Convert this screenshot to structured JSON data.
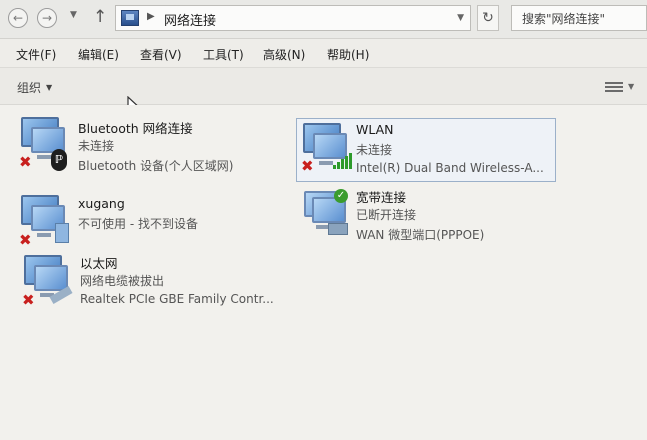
{
  "address": {
    "back_icon": "back-arrow-icon",
    "forward_icon": "forward-arrow-icon",
    "up_icon": "up-arrow-icon",
    "breadcrumb_separator": "▶",
    "path": "网络连接",
    "refresh_icon": "refresh-icon",
    "search_placeholder": "搜索\"网络连接\""
  },
  "menu": {
    "items": [
      {
        "label": "文件(F)"
      },
      {
        "label": "编辑(E)"
      },
      {
        "label": "查看(V)"
      },
      {
        "label": "工具(T)"
      },
      {
        "label": "高级(N)"
      },
      {
        "label": "帮助(H)"
      }
    ]
  },
  "toolbar": {
    "organize_label": "组织",
    "view_icon": "change-view-icon"
  },
  "connections": [
    {
      "name": "Bluetooth 网络连接",
      "status": "未连接",
      "device": "Bluetooth 设备(个人区域网)",
      "state": "disconnected",
      "type": "bluetooth"
    },
    {
      "name": "WLAN",
      "status": "未连接",
      "device": "Intel(R) Dual Band Wireless-A...",
      "state": "disconnected",
      "type": "wireless",
      "selected": true
    },
    {
      "name": "xugang",
      "status": "不可使用 - 找不到设备",
      "device": "",
      "state": "disconnected",
      "type": "vpn"
    },
    {
      "name": "宽带连接",
      "status": "已断开连接",
      "device": "WAN 微型端口(PPPOE)",
      "state": "ok",
      "type": "broadband"
    },
    {
      "name": "以太网",
      "status": "网络电缆被拔出",
      "device": "Realtek PCIe GBE Family Contr...",
      "state": "disconnected",
      "type": "ethernet"
    }
  ],
  "colors": {
    "error_red": "#c8201e",
    "ok_green": "#3b9c2d",
    "selection_border": "#9bb0c9"
  }
}
